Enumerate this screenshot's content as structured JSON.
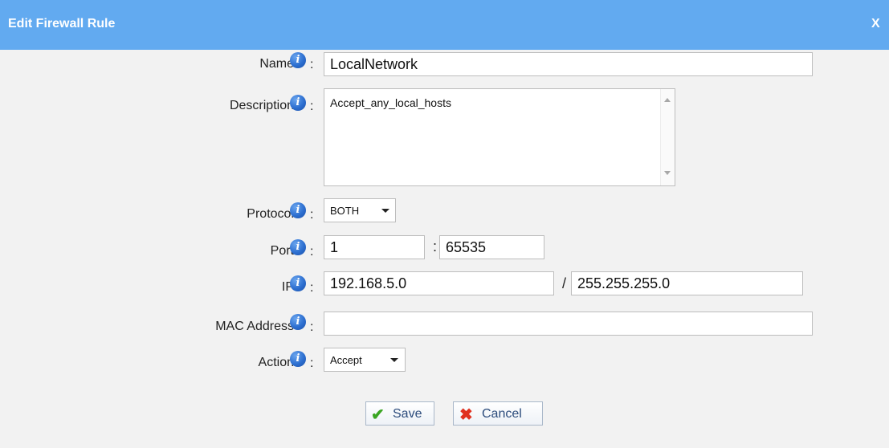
{
  "dialog": {
    "title": "Edit Firewall Rule",
    "close_label": "X"
  },
  "info_glyph": "i",
  "colon": ":",
  "fields": {
    "name": {
      "label": "Name",
      "value": "LocalNetwork"
    },
    "description": {
      "label": "Description",
      "value": "Accept_any_local_hosts"
    },
    "protocol": {
      "label": "Protocol",
      "value": "BOTH"
    },
    "port": {
      "label": "Port",
      "from": "1",
      "separator": ":",
      "to": "65535"
    },
    "ip": {
      "label": "IP",
      "address": "192.168.5.0",
      "separator": "/",
      "mask": "255.255.255.0"
    },
    "mac": {
      "label": "MAC Address",
      "value": ""
    },
    "action": {
      "label": "Action",
      "value": "Accept"
    }
  },
  "buttons": {
    "save": {
      "label": "Save",
      "icon": "check-icon"
    },
    "cancel": {
      "label": "Cancel",
      "icon": "x-icon"
    }
  },
  "colors": {
    "titlebar": "#62aaf0",
    "background": "#f2f2f2",
    "save_icon": "#3aa623",
    "cancel_icon": "#e0301e"
  }
}
